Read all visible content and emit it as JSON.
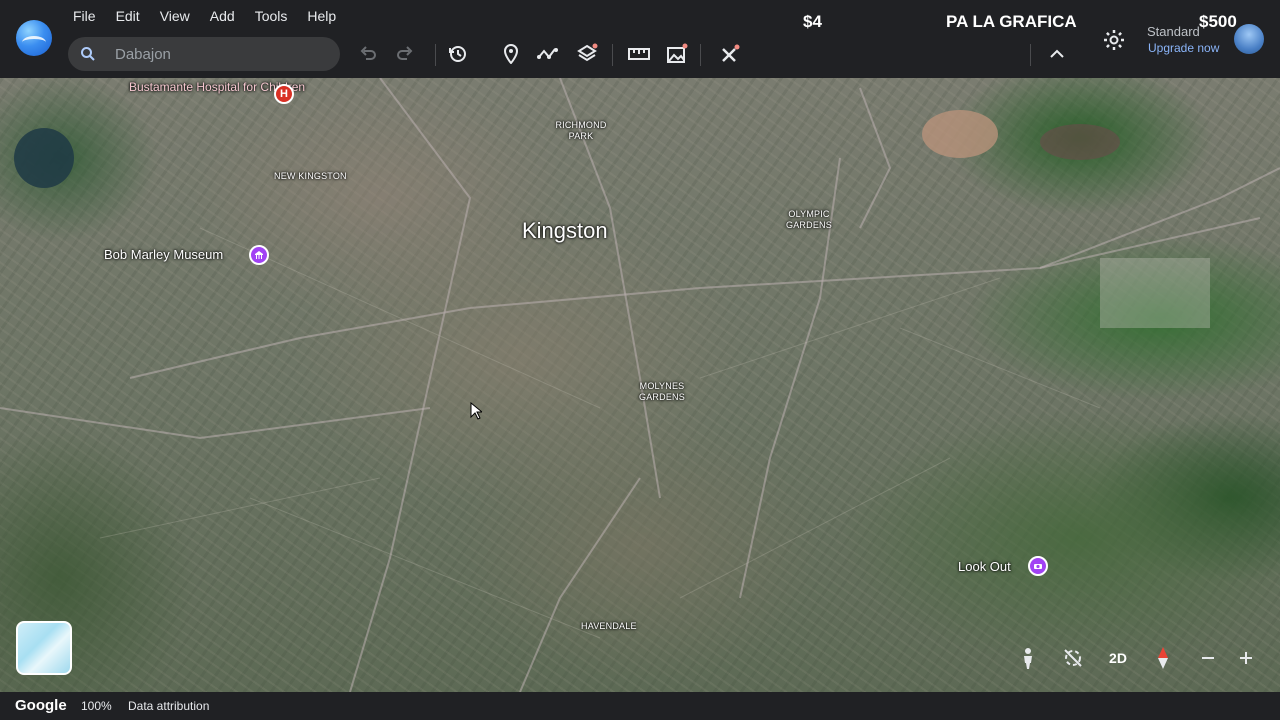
{
  "menu": [
    "File",
    "Edit",
    "View",
    "Add",
    "Tools",
    "Help"
  ],
  "search": {
    "placeholder": "Dabajon"
  },
  "toolbar": {
    "icons": [
      "undo-icon",
      "redo-icon",
      "history-icon",
      "placemark-icon",
      "path-icon",
      "layers-icon",
      "ruler-icon",
      "image-overlay-icon",
      "tools-icon",
      "collapse-icon"
    ]
  },
  "overlay": {
    "left_price": "$4",
    "title": "PA LA GRAFICA",
    "right_price": "$500"
  },
  "account": {
    "plan": "Standard",
    "upgrade": "Upgrade now"
  },
  "map": {
    "city": "Kingston",
    "hospital": "Bustamante Hospital for Children",
    "hospital_marker": "H",
    "museum": "Bob Marley Museum",
    "lookout": "Look Out",
    "areas": {
      "richmond_park": "RICHMOND PARK",
      "new_kingston": "NEW KINGSTON",
      "olympic_gardens": "OLYMPIC GARDENS",
      "molynes_gardens": "MOLYNES GARDENS",
      "havendale": "HAVENDALE"
    }
  },
  "controls": {
    "view_mode": "2D"
  },
  "footer": {
    "brand": "Google",
    "zoom": "100%",
    "attribution": "Data attribution"
  },
  "colors": {
    "accent": "#8ab4f8",
    "hospital": "#d93025",
    "poi": "#a142f4",
    "bar": "#202124"
  }
}
